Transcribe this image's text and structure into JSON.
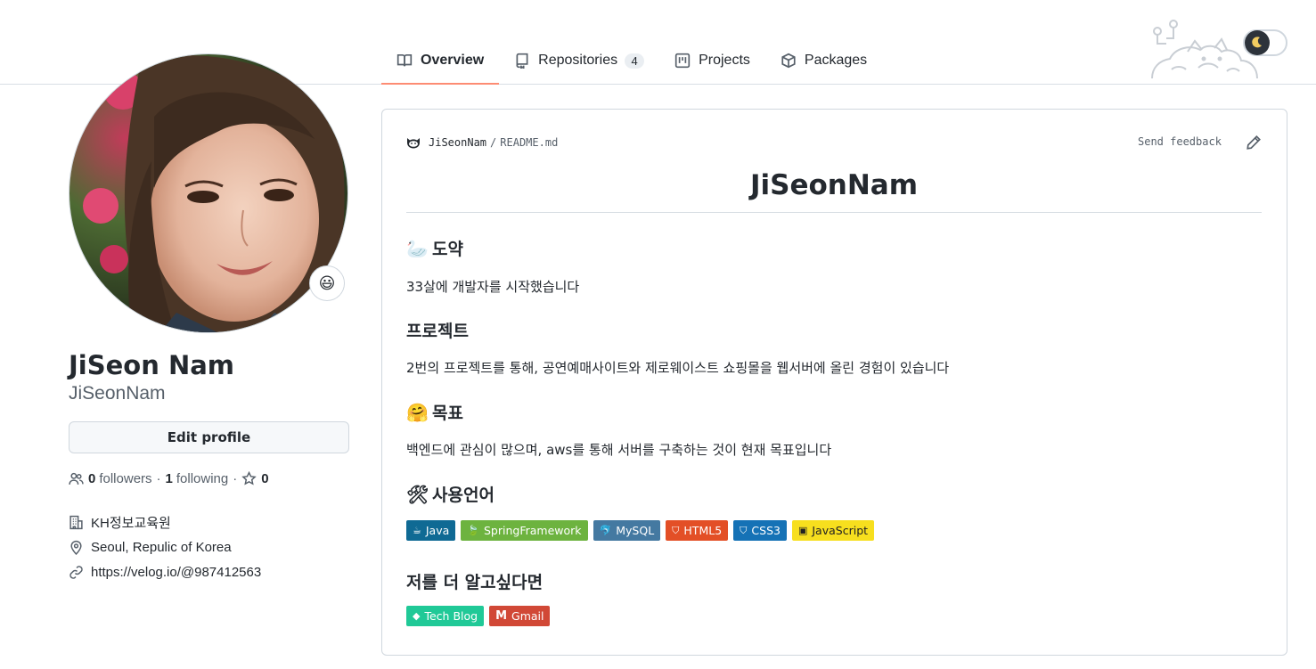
{
  "tabs": [
    {
      "label": "Overview",
      "icon": "book-icon",
      "active": true
    },
    {
      "label": "Repositories",
      "icon": "repo-icon",
      "count": "4"
    },
    {
      "label": "Projects",
      "icon": "project-icon"
    },
    {
      "label": "Packages",
      "icon": "package-icon"
    }
  ],
  "theme_toggle": {
    "icon": "moon-icon"
  },
  "profile": {
    "full_name": "JiSeon Nam",
    "username": "JiSeonNam",
    "status_emoji": "😃",
    "edit_label": "Edit profile",
    "followers_count": "0",
    "followers_label": "followers",
    "following_count": "1",
    "following_label": "following",
    "stars_count": "0",
    "company": "KH정보교육원",
    "location": "Seoul, Repulic of Korea",
    "website": "https://velog.io/@987412563"
  },
  "readme": {
    "owner": "JiSeonNam",
    "file": "README.md",
    "feedback_label": "Send feedback",
    "title": "JiSeonNam",
    "sections": [
      {
        "emoji": "🦢",
        "heading": "도약",
        "text": "33살에 개발자를 시작했습니다"
      },
      {
        "emoji": "",
        "heading": "프로젝트",
        "text": "2번의 프로젝트를 통해, 공연예매사이트와 제로웨이스트 쇼핑몰을 웹서버에 올린 경험이 있습니다"
      },
      {
        "emoji": "🤗",
        "heading": "목표",
        "text": "백엔드에 관심이 많으며, aws를 통해 서버를 구축하는 것이 현재 목표입니다"
      },
      {
        "emoji": "🛠",
        "heading": "사용언어",
        "text": ""
      },
      {
        "emoji": "",
        "heading": "저를 더 알고싶다면",
        "text": ""
      }
    ],
    "skill_badges": [
      {
        "label": "Java",
        "color": "#0F6A94",
        "icon": "java-icon"
      },
      {
        "label": "SpringFramework",
        "color": "#6DB33F",
        "icon": "spring-icon"
      },
      {
        "label": "MySQL",
        "color": "#4479A1",
        "icon": "mysql-icon"
      },
      {
        "label": "HTML5",
        "color": "#E34F26",
        "icon": "html5-icon"
      },
      {
        "label": "CSS3",
        "color": "#1572B6",
        "icon": "css3-icon"
      },
      {
        "label": "JavaScript",
        "color": "#F7DF1E",
        "icon": "javascript-icon"
      }
    ],
    "contact_badges": [
      {
        "label": "Tech Blog",
        "color": "#20C997",
        "icon": "velog-icon"
      },
      {
        "label": "Gmail",
        "color": "#D14836",
        "icon": "gmail-icon"
      }
    ]
  }
}
